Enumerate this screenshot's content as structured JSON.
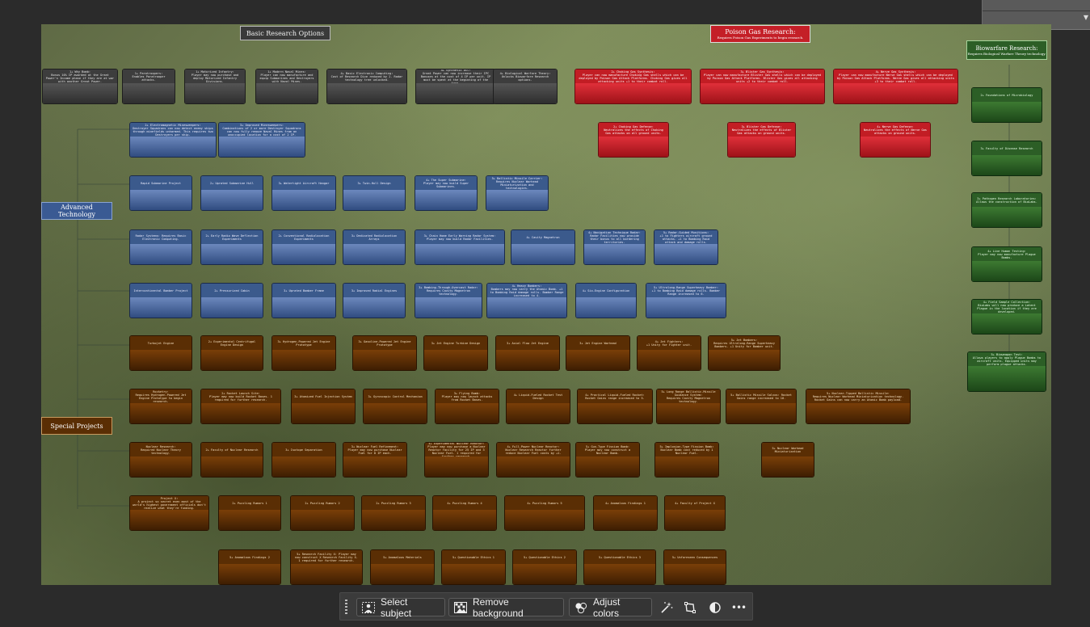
{
  "toolbar": {
    "select_subject": "Select subject",
    "remove_background": "Remove background",
    "adjust_colors": "Adjust colors",
    "more": "•••"
  },
  "sections": {
    "basic": "Basic Research Options",
    "poison": "Poison Gas Research:",
    "poison_sub": "Requires Poison Gas Experiments to begin research.",
    "bio": "Biowarfare Research:",
    "bio_sub": "Requires Biological Warfare Theory technology.",
    "advanced": "Advanced\nTechnology",
    "special": "Special Projects"
  },
  "nodes": {
    "gray": [
      "1+ Why Bomb:\nBonus 10% IP awarded at the Great Power's Income phase if they are at war with another Great Power.",
      "1+ Paratroopers:\nEnables Paratrooper attacks.",
      "1+ Motorized Infantry:\nPlayer may now purchase and deploy Motorized Infantry Divisions.",
      "1+ Modern Naval Mines:\nPlayer can now manufacture and equip Submarines and Destroyers with Naval Mines.",
      "4+ Basic Electronic Computing:\nCost of Research Dice reduced by 1. Radar technology tree unlocked.",
      "4+ Synthetic Oil:\nGreat Power can now increase their IPC Bonuses at the cost of 4 IP per unit. IP must be spent at the beginning of the turn.",
      "4+ Biological Warfare Theory:\nUnlocks Biowarfare Research options."
    ],
    "red_top": [
      "2+ Choking Gas Synthesis:\nPlayer can now manufacture Choking Gas shells which can be deployed by Poison Gas Attack Platforms. Choking Gas gives all attacking units +1 to their combat roll.",
      "3+ Blister Gas Synthesis:\nPlayer can now manufacture Blister Gas shells which can be deployed by Poison Gas Attack Platforms. Blister Gas gives all attacking units +2 to their combat roll.",
      "4+ Nerve Gas Synthesis:\nPlayer can now manufacture Nerve Gas shells which can be deployed by Poison Gas Attack Platforms. Nerve Gas gives all attacking units +3 to their combat roll."
    ],
    "red_bottom": [
      "2+ Choking Gas Defense:\nNeutralizes the effects of Choking Gas attacks on all ground units.",
      "3+ Blister Gas Defense:\nNeutralizes the effects of Blister Gas attacks on ground units.",
      "4+ Nerve Gas Defense:\nNeutralizes the effects of Nerve Gas attacks on ground units."
    ],
    "green": [
      "2+ Foundations of Microbiology",
      "3+ Faculty of Disease Research",
      "3+ Pathogen Research Laboratories:\nAllows the construction of BioLabs.",
      "4+ Live Human Testing:\nPlayer may now manufacture Plague Bombs.",
      "4+ Field Sample Collection:\nBioLabs will now produce a Latent Plague in the location if they are developed.",
      "5+ Bioweapon Test:\nAllows players to apply Plague Bombs to aircraft units. Equipped units may perform plague attacks."
    ],
    "blue_row1": [
      "2+ Electromagnetic Minesweepers:\nDestroyer Squadrons can now detect enemy ships through minefields unharmed. This requires two Destroyers per ship.",
      "3+ Improved Minesweepers:\nCombinations of 2 or more Destroyer Squadrons can now fully remove Naval Mines from an unoccupied location for a cost of 2 IP."
    ],
    "blue_row2": [
      "Rapid Submarine Project",
      "2+ Uprated Submarine Hull",
      "3+ Watertight Aircraft Hangar",
      "3+ Twin-Hull Design",
      "4+ The Super Submarine:\nPlayer may now build Super Submarines.",
      "5+ Ballistic Missile Carrier:\nRequires Nuclear Warhead Miniaturization and technologies."
    ],
    "blue_row3": [
      "Radar Systems: Requires Basic Electronic Computing.",
      "2+ Early Radio Wave Deflection Experiments",
      "2+ Conventional Radiolocation Experiments",
      "3+ Dedicated Radiolocation Arrays",
      "3+ Chain Home Early Warning Radar System:\nPlayer may now build Radar Facilities.",
      "4+ Cavity Magnetron",
      "4+ Navigation Technique Radar:\nRadar Facilities now provide their bonus to all bordering territories.",
      "5+ Radar-Guided Munitions:\n+1 to Fighters aircraft ground attacks. +1 to Bombing Raid attack and damage rolls."
    ],
    "blue_row4": [
      "Intercontinental Bomber Project",
      "2+ Pressurized Cabin",
      "3+ Uprated Bomber Frame",
      "3+ Improved Radial Engines",
      "3+ Bombing-Through-Overcast Radar:\nRequires Cavity Magnetron technology.",
      "4+ Heavy Bombers:\nBombers may now carry the Atomic Bomb. +1 to Bombing Raid damage rolls. Bomber Range increased to 4.",
      "4+ Six-Engine Configuration",
      "5+ Ultralong-Range Superheavy Bomber:\n+1 to Bombing Raid damage rolls. Bomber Range increased to 6."
    ],
    "brown_row1": [
      "Turbojet Engine",
      "2+ Experimental Centrifugal Engine Design",
      "3+ Hydrogen-Powered Jet Engine Prototype",
      "3+ Gasoline-Powered Jet Engine Prototype",
      "3+ Jet Engine Turbine Design",
      "3+ Axial Flow Jet Engine",
      "3+ Jet Engine Warhead",
      "4+ Jet Fighters:\n+1 Unity for Fighter unit.",
      "5+ Jet Bombers:\nRequires Ultralong-Range Superheavy Bombers. +1 Unity for Bomber unit."
    ],
    "brown_row2": [
      "Rocketry:\nRequires Hydrogen-Powered Jet Engine Prototype to begin research.",
      "2+ Rocket Launch Site:\nPlayer may now build Rocket Bases. 1 required for further research.",
      "3+ Atomized Fuel Injection System",
      "3+ Gyroscopic Control Mechanism",
      "3+ Flying Bomb:\nPlayer may now launch attacks from Rocket Bases.",
      "4+ Liquid-Fueled Rocket Test Design",
      "4+ Practical Liquid-Fueled Rocket:\nRocket Gains range increased to 5.",
      "5+ Long Range Ballistic-Missile Guidance System:\nRequires Cavity Magnetron technology.",
      "5+ Ballistic Missile Salvos: Rocket Gains range increased to 10.",
      "5+ Nuclear-Tipped Ballistic Missile:\nRequires Nuclear Warhead Miniaturization technology. Rocket Gains can now carry an Atomic Bomb payload."
    ],
    "brown_row3": [
      "Nuclear Research:\nRequired Nuclear Theory technology.",
      "2+ Faculty of Nuclear Research",
      "3+ Isotope Separation",
      "3+ Nuclear Fuel Refinement:\nPlayer may now purchase Nuclear Fuel for 8 IP each.",
      "4+ Experimental Nuclear Reactor:\nPlayer may now purchase a Nuclear Reactor facility for 25 IP and 3 Nuclear Fuel. 1 required for further research.",
      "4+ Full-Power Nuclear Reactor:\nNuclear Research Reactor further reduce Nuclear Fuel costs by +1.",
      "5+ Gun-Type Fission Bomb:\nPlayer may now construct a Nuclear Bomb.",
      "5+ Implosion-Type Fission Bomb:\nNuclear Bomb cost reduced by 1 Nuclear Fuel.",
      "5+ Nuclear Warhead Miniaturization"
    ],
    "brown_row4": [
      "Project X:\nA project so secret even most of the world's highest government officials don't realize what they're funding.",
      "2+ Puzzling Rumors 1",
      "2+ Puzzling Rumors 2",
      "2+ Puzzling Rumors 3",
      "4+ Puzzling Rumors 4",
      "4+ Puzzling Rumors 5",
      "4+ Anomalous Findings 1",
      "4+ Faculty of Project X"
    ],
    "brown_row5": [
      "5+ Anomalous Findings 2",
      "5+ Research Facility X: Player may now construct X Research Facility X. 1 required for further research.",
      "5+ Anomalous Materials",
      "5+ Questionable Ethics 1",
      "5+ Questionable Ethics 2",
      "5+ Questionable Ethics 3",
      "5+ Unforeseen Consequences"
    ]
  }
}
